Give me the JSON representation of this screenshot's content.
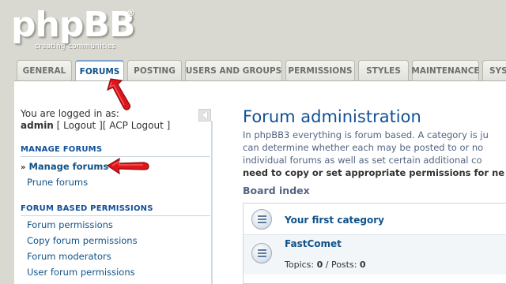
{
  "logo": {
    "word": "phpBB",
    "registered": "®",
    "tagline": "creating  communities"
  },
  "tabs": [
    {
      "label": "GENERAL",
      "active": false
    },
    {
      "label": "FORUMS",
      "active": true
    },
    {
      "label": "POSTING",
      "active": false
    },
    {
      "label": "USERS AND GROUPS",
      "active": false
    },
    {
      "label": "PERMISSIONS",
      "active": false
    },
    {
      "label": "STYLES",
      "active": false
    },
    {
      "label": "MAINTENANCE",
      "active": false
    },
    {
      "label": "SYS",
      "active": false
    }
  ],
  "sidebar": {
    "logged_in_text": "You are logged in as:",
    "username": "admin",
    "bracket_open": " [ ",
    "logout": "Logout",
    "bracket_mid": " ][ ",
    "acp_logout": "ACP Logout",
    "bracket_close": " ]",
    "sections": [
      {
        "heading": "MANAGE FORUMS",
        "items": [
          {
            "label": "Manage forums",
            "active": true,
            "bullet": "»"
          },
          {
            "label": "Prune forums",
            "active": false
          }
        ]
      },
      {
        "heading": "FORUM BASED PERMISSIONS",
        "items": [
          {
            "label": "Forum permissions"
          },
          {
            "label": "Copy forum permissions"
          },
          {
            "label": "Forum moderators"
          },
          {
            "label": "User forum permissions"
          }
        ]
      }
    ]
  },
  "content": {
    "title": "Forum administration",
    "lines": [
      "In phpBB3 everything is forum based. A category is ju",
      "can determine whether each may be posted to or no",
      "individual forums as well as set certain additional co"
    ],
    "strong_line": "need to copy or set appropriate permissions for ne",
    "board_index": "Board index",
    "category": "Your first category",
    "forum": "FastComet",
    "topics_label": "Topics: ",
    "topics": "0",
    "sep": " / Posts: ",
    "posts": "0"
  },
  "colors": {
    "accent": "#105289",
    "arrow": "#e0141c",
    "background": "#d9d8d1"
  }
}
